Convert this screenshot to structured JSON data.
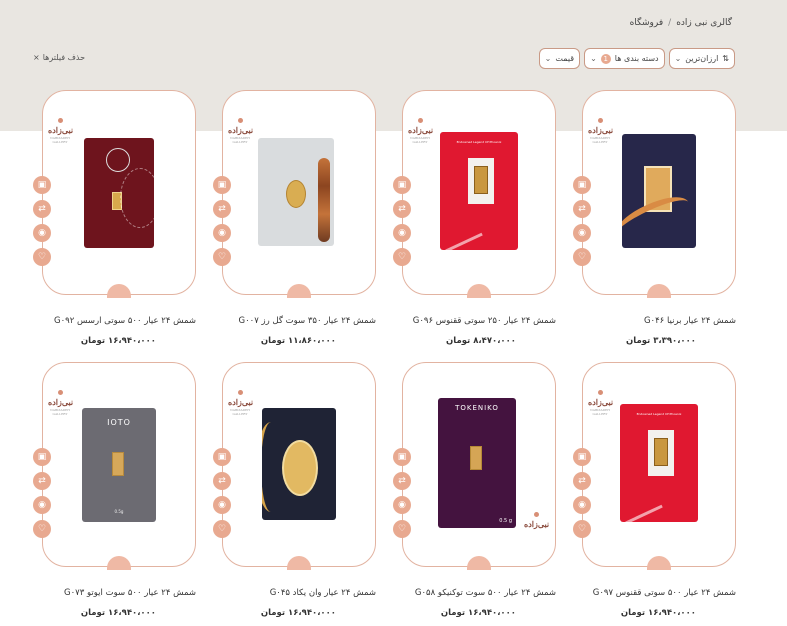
{
  "breadcrumb": {
    "home": "گالری نبی زاده",
    "separator": "/",
    "current": "فروشگاه"
  },
  "filters": {
    "sort_label": "ارزان‌ترین",
    "category_label": "دسته بندی ها",
    "category_count": "1",
    "price_label": "قیمت",
    "clear_label": "حذف فیلترها",
    "clear_icon": "×"
  },
  "logo": {
    "text": "نبی‌زاده",
    "sub": "NABIZADEH GALLERY"
  },
  "products": [
    {
      "title": "شمش ۲۴ عیار برنیا G۰۴۶",
      "price": "۳،۳۹۰،۰۰۰ تومان",
      "image": "navy-card"
    },
    {
      "title": "شمش ۲۴ عیار ۲۵۰ سوتی ققنوس G۰۹۶",
      "price": "۸،۴۷۰،۰۰۰ تومان",
      "image": "red-phoenix-card"
    },
    {
      "title": "شمش ۲۴ عیار ۳۵۰ سوت گل رز G۰۰۷",
      "price": "۱۱،۸۶۰،۰۰۰ تومان",
      "image": "silver-rose-card"
    },
    {
      "title": "شمش ۲۴ عیار ۵۰۰ سوتی ارسس G۰۹۲",
      "price": "۱۶،۹۴۰،۰۰۰ تومان",
      "image": "maroon-card"
    },
    {
      "title": "شمش ۲۴ عیار ۵۰۰ سوتی ققنوس G۰۹۷",
      "price": "۱۶،۹۴۰،۰۰۰ تومان",
      "image": "red-phoenix-card"
    },
    {
      "title": "شمش ۲۴ عیار ۵۰۰ سوت توکنیکو G۰۵۸",
      "price": "۱۶،۹۴۰،۰۰۰ تومان",
      "image": "purple-tokeniko-card",
      "brand": "TOKENIKO",
      "weight": "0.5 g"
    },
    {
      "title": "شمش ۲۴ عیار وان یکاد G۰۴۵",
      "price": "۱۶،۹۴۰،۰۰۰ تومان",
      "image": "darknavy-card"
    },
    {
      "title": "شمش ۲۴ عیار ۵۰۰ سوت ایوتو G۰۷۳",
      "price": "۱۶،۹۴۰،۰۰۰ تومان",
      "image": "gray-ioto-card",
      "brand": "IOTO",
      "weight": "0.5g"
    }
  ],
  "card_texts": {
    "phoenix": "Endowned Legend Of Phoenix"
  },
  "icons": {
    "cart": "cart-icon",
    "compare": "shuffle-icon",
    "view": "eye-icon",
    "wishlist": "heart-icon"
  },
  "colors": {
    "accent": "#e8a990",
    "band": "#e9e6e1",
    "border": "#e2b3a1"
  }
}
